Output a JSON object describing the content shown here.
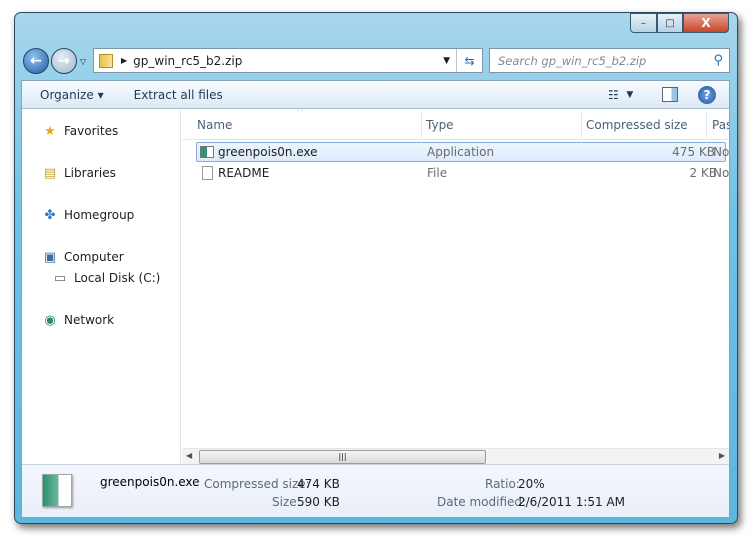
{
  "window": {
    "controls": {
      "minimize": "–",
      "maximize": "□",
      "close": "X"
    }
  },
  "address": {
    "path": "gp_win_rc5_b2.zip"
  },
  "search": {
    "placeholder": "Search gp_win_rc5_b2.zip"
  },
  "toolbar": {
    "organize": "Organize ▾",
    "extract": "Extract all files"
  },
  "sidebar": {
    "items": [
      {
        "label": "Favorites",
        "icon": "star-icon"
      },
      {
        "label": "Libraries",
        "icon": "libraries-icon"
      },
      {
        "label": "Homegroup",
        "icon": "homegroup-icon"
      },
      {
        "label": "Computer",
        "icon": "computer-icon"
      },
      {
        "label": "Local Disk (C:)",
        "icon": "drive-icon"
      },
      {
        "label": "Network",
        "icon": "network-icon"
      }
    ]
  },
  "columns": {
    "name": "Name",
    "type": "Type",
    "compressed": "Compressed size",
    "password": "Pas"
  },
  "files": [
    {
      "name": "greenpois0n.exe",
      "type": "Application",
      "compressed": "475 KB",
      "password": "No",
      "selected": true
    },
    {
      "name": "README",
      "type": "File",
      "compressed": "2 KB",
      "password": "No",
      "selected": false
    }
  ],
  "details": {
    "name": "greenpois0n.exe",
    "compressed_label": "Compressed size:",
    "compressed_value": "474 KB",
    "size_label": "Size:",
    "size_value": "590 KB",
    "ratio_label": "Ratio:",
    "ratio_value": "20%",
    "date_label": "Date modified:",
    "date_value": "2/6/2011 1:51 AM"
  }
}
